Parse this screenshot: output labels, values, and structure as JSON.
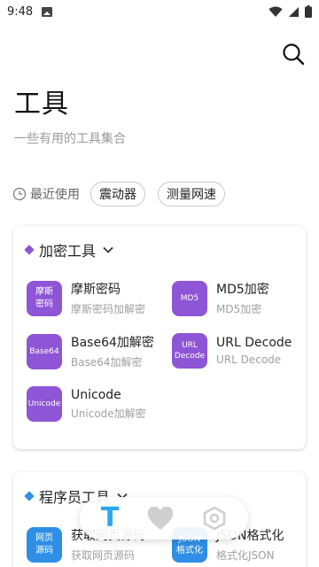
{
  "status": {
    "time": "9:48"
  },
  "page": {
    "title": "工具",
    "subtitle": "一些有用的工具集合"
  },
  "recent": {
    "label": "最近使用",
    "chips": [
      "震动器",
      "测量网速"
    ]
  },
  "sections": [
    {
      "title": "加密工具",
      "color": "#8e55d6",
      "tools": [
        {
          "icon_text": "摩斯\n密码",
          "name": "摩斯密码",
          "desc": "摩斯密码加解密"
        },
        {
          "icon_text": "MD5",
          "name": "MD5加密",
          "desc": "MD5加密"
        },
        {
          "icon_text": "Base64",
          "name": "Base64加解密",
          "desc": "Base64加解密"
        },
        {
          "icon_text": "URL\nDecode",
          "name": "URL Decode",
          "desc": "URL Decode"
        },
        {
          "icon_text": "Unicode",
          "name": "Unicode",
          "desc": "Unicode加解密"
        }
      ]
    },
    {
      "title": "程序员工具",
      "color": "#2f8fe6",
      "tools": [
        {
          "icon_text": "网页\n源码",
          "name": "获取网页源码",
          "desc": "获取网页源码"
        },
        {
          "icon_text": "JSON\n格式化",
          "name": "JSON格式化",
          "desc": "格式化JSON"
        }
      ]
    }
  ],
  "nav": {
    "tools_label": "T"
  },
  "colors": {
    "accent": "#29a8f0",
    "crypto": "#8e55d6",
    "dev": "#2f8fe6"
  }
}
